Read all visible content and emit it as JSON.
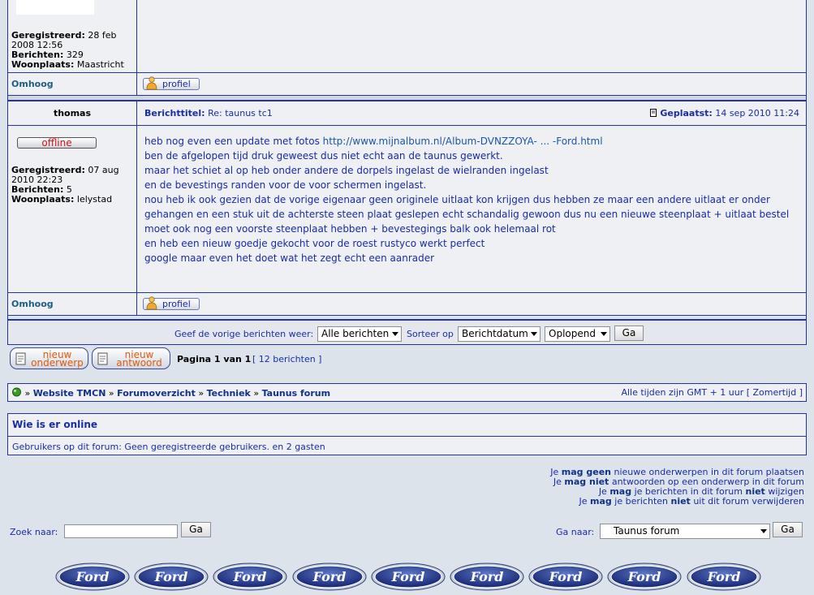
{
  "post1": {
    "registered_label": "Geregistreerd:",
    "registered_value": "28 feb 2008 12:56",
    "posts_label": "Berichten:",
    "posts_value": "329",
    "location_label": "Woonplaats:",
    "location_value": "Maastricht",
    "top_link": "Omhoog",
    "profile_label": "profiel"
  },
  "post2": {
    "author": "thomas",
    "status": "offline",
    "subject_label": "Berichttitel:",
    "subject_value": "Re: taunus tc1",
    "posted_label": "Geplaatst:",
    "posted_value": "14 sep 2010 11:24",
    "registered_label": "Geregistreerd:",
    "registered_value": "07 aug 2010 22:23",
    "posts_label": "Berichten:",
    "posts_value": "5",
    "location_label": "Woonplaats:",
    "location_value": "lelystad",
    "body_line1_text": "heb nog even een update met fotos ",
    "body_line1_link": "http://www.mijnalbum.nl/Album-DVNZZOYA- ... -Ford.html",
    "body_lines": [
      "ben de afgelopen tijd druk geweest dus niet echt aan de taunus gewerkt.",
      "maar het schiet al op heb onder andere de dorpels ingelast de wielranden ingelast",
      "en de bevestings randen voor de voor schermen ingelast.",
      "nou heb ik ook gezien dat de vorige eigenaar geen originele uitlaat kon krijgen dus hebben ze maar een andere uitlaat er onder",
      "gehangen en een stuk uit de achterste steen plaat geslepen echt schandalig gewoon dus nu een nieuwe steenplaat + uitlaat bestel",
      "moet ook nog een voorste steenplaat hebben + bevestegings balk ook helemaal rot",
      "en heb een nieuw goedje gekocht voor de roest rustyco werkt perfect",
      "google maar even het doet wat het zegt echt een aanrader"
    ],
    "top_link": "Omhoog",
    "profile_label": "profiel"
  },
  "filter": {
    "show_label": "Geef de vorige berichten weer:",
    "show_value": "Alle berichten",
    "sort_label": "Sorteer op",
    "sort_value": "Berichtdatum",
    "order_value": "Oplopend",
    "go_label": "Ga"
  },
  "actions": {
    "new_topic_line1": "nieuw",
    "new_topic_line2": "onderwerp",
    "new_reply_line1": "nieuw",
    "new_reply_line2": "antwoord",
    "pagination": "Pagina 1 van 1",
    "posts_count": "[ 12 berichten ]"
  },
  "breadcrumb": {
    "sep": "»",
    "items": [
      "Website TMCN",
      "Forumoverzicht",
      "Techniek",
      "Taunus forum"
    ],
    "timezone": "Alle tijden zijn GMT + 1 uur [ Zomertijd ]"
  },
  "online": {
    "title": "Wie is er online",
    "text": "Gebruikers op dit forum: Geen geregistreerde gebruikers. en 2 gasten"
  },
  "permissions": [
    {
      "pre": "Je ",
      "bold": "mag geen",
      "post": " nieuwe onderwerpen in dit forum plaatsen"
    },
    {
      "pre": "Je ",
      "bold": "mag niet",
      "post": " antwoorden op een onderwerp in dit forum"
    },
    {
      "pre": "Je ",
      "bold": "mag",
      "mid": " je berichten in dit forum ",
      "bold2": "niet",
      "post": " wijzigen"
    },
    {
      "pre": "Je ",
      "bold": "mag",
      "mid": " je berichten ",
      "bold2": "niet",
      "post": " uit dit forum verwijderen"
    }
  ],
  "search": {
    "label": "Zoek naar:",
    "value": "",
    "go_label": "Ga"
  },
  "jump": {
    "label": "Ga naar:",
    "value": "Taunus forum",
    "go_label": "Ga"
  },
  "footer_logo_text": "Ford",
  "colors": {
    "border": "#2333a3",
    "cell": "#eef0f3",
    "page": "#dde3ea",
    "offline": "#c8141d",
    "button_text": "#e25a08"
  }
}
